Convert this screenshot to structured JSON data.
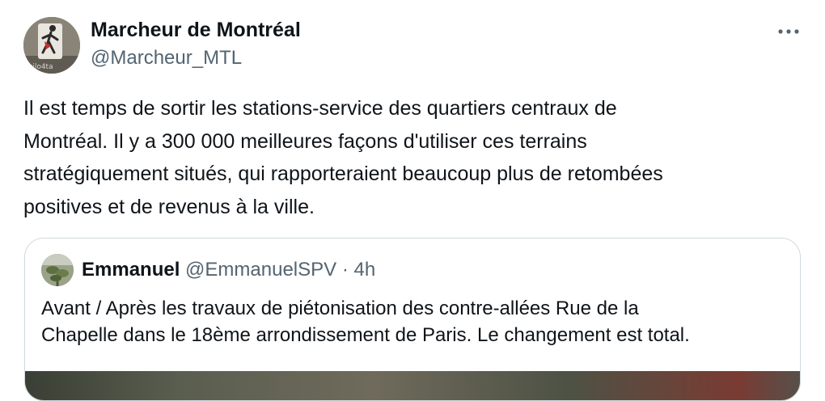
{
  "author": {
    "display_name": "Marcheur de Montréal",
    "handle": "@Marcheur_MTL",
    "avatar_icon": "walker-sign-avatar"
  },
  "more_icon": "more-horizontal-icon",
  "tweet": {
    "text": "Il est temps de sortir les stations-service des quartiers centraux de\nMontréal. Il y a 300 000 meilleures façons d'utiliser ces terrains\nstratégiquement situés, qui rapporteraient beaucoup plus de retombées\npositives et de revenus à la ville."
  },
  "quoted": {
    "display_name": "Emmanuel",
    "handle": "@EmmanuelSPV",
    "separator": "·",
    "time": "4h",
    "text": "Avant / Après les travaux de piétonisation des contre-allées Rue de la\nChapelle dans le 18ème arrondissement  de Paris. Le changement est total.",
    "avatar_icon": "plant-avatar"
  },
  "colors": {
    "text_primary": "#0f1419",
    "text_secondary": "#536471",
    "border": "#cfd9de"
  }
}
